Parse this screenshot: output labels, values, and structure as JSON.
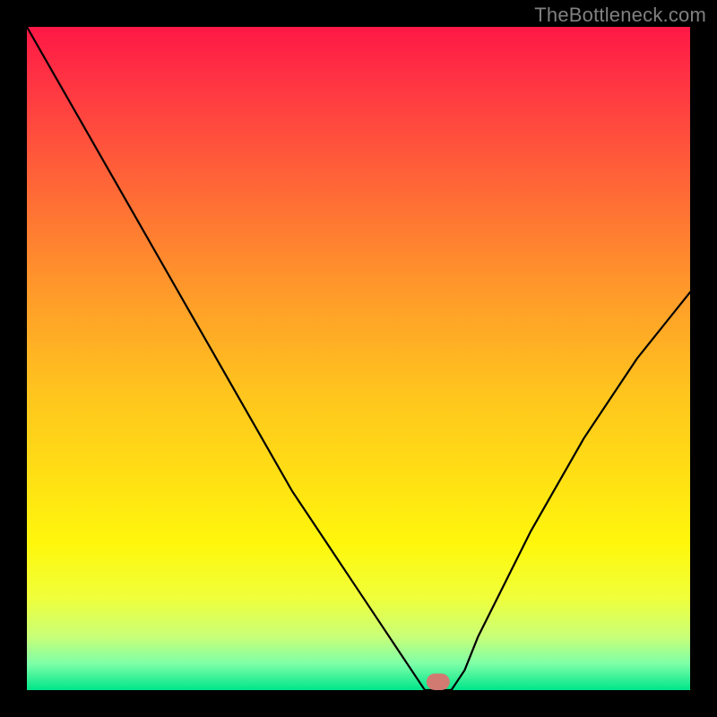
{
  "watermark": "TheBottleneck.com",
  "chart_data": {
    "type": "line",
    "title": "",
    "xlabel": "",
    "ylabel": "",
    "xlim": [
      0,
      100
    ],
    "ylim": [
      0,
      100
    ],
    "background_gradient": {
      "stops": [
        {
          "offset": 0.0,
          "color": "#ff1846"
        },
        {
          "offset": 0.1,
          "color": "#ff3a42"
        },
        {
          "offset": 0.25,
          "color": "#ff6a36"
        },
        {
          "offset": 0.4,
          "color": "#ff9a2a"
        },
        {
          "offset": 0.55,
          "color": "#ffc41e"
        },
        {
          "offset": 0.68,
          "color": "#ffe014"
        },
        {
          "offset": 0.78,
          "color": "#fff70c"
        },
        {
          "offset": 0.86,
          "color": "#f0ff3a"
        },
        {
          "offset": 0.92,
          "color": "#c8ff78"
        },
        {
          "offset": 0.96,
          "color": "#7effa8"
        },
        {
          "offset": 1.0,
          "color": "#00e58a"
        }
      ]
    },
    "series": [
      {
        "name": "bottleneck-curve",
        "color": "#000000",
        "stroke_width": 2.2,
        "x": [
          0,
          4,
          8,
          12,
          16,
          20,
          24,
          28,
          32,
          36,
          40,
          44,
          48,
          52,
          56,
          58,
          60,
          62,
          64,
          66,
          68,
          72,
          76,
          80,
          84,
          88,
          92,
          96,
          100
        ],
        "values": [
          100,
          93,
          86,
          79,
          72,
          65,
          58,
          51,
          44,
          37,
          30,
          24,
          18,
          12,
          6,
          3,
          0,
          0,
          0,
          3,
          8,
          16,
          24,
          31,
          38,
          44,
          50,
          55,
          60
        ]
      }
    ],
    "marker": {
      "name": "target-marker",
      "x": 62,
      "y": 0,
      "width": 3.5,
      "height": 2.5,
      "fill": "#d07a72"
    },
    "grid": false,
    "legend": null
  }
}
